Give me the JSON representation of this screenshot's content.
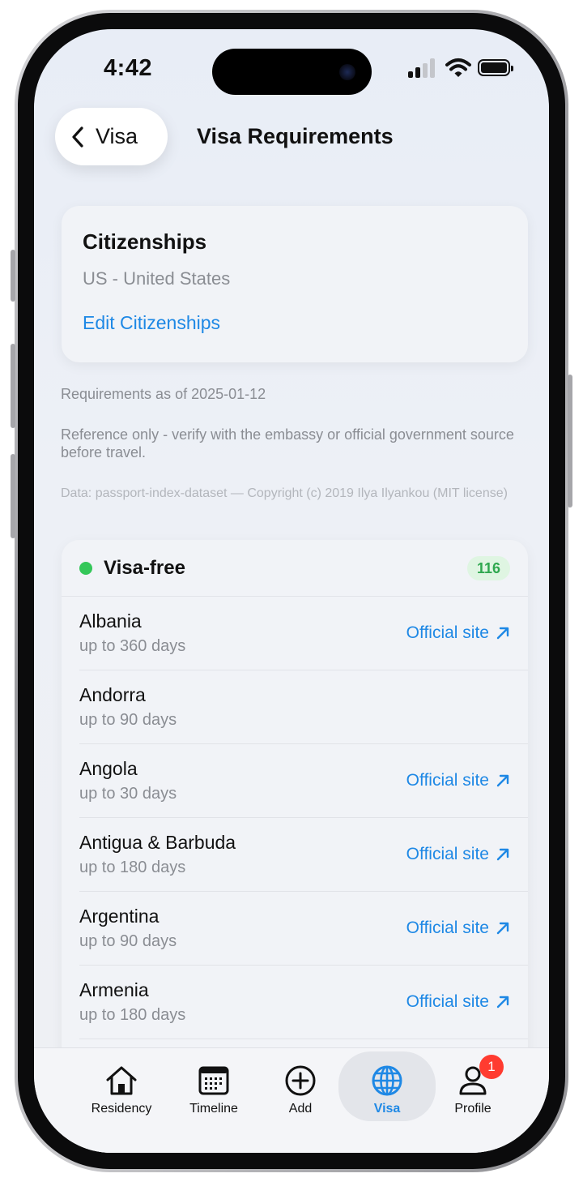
{
  "status": {
    "time": "4:42"
  },
  "nav": {
    "back_label": "Visa",
    "title": "Visa Requirements"
  },
  "citizenships": {
    "title": "Citizenships",
    "value": "US - United States",
    "edit_label": "Edit Citizenships"
  },
  "meta": {
    "as_of": "Requirements as of 2025-01-12",
    "disclaimer": "Reference only - verify with the embassy or official government source before travel.",
    "data_source": "Data: passport-index-dataset — Copyright (c) 2019 Ilya Ilyankou (MIT license)"
  },
  "visa_free": {
    "label": "Visa-free",
    "count": "116",
    "status_color": "#34c759",
    "rows": [
      {
        "country": "Albania",
        "duration": "up to 360 days",
        "link": "Official site"
      },
      {
        "country": "Andorra",
        "duration": "up to 90 days",
        "link": ""
      },
      {
        "country": "Angola",
        "duration": "up to 30 days",
        "link": "Official site"
      },
      {
        "country": "Antigua & Barbuda",
        "duration": "up to 180 days",
        "link": "Official site"
      },
      {
        "country": "Argentina",
        "duration": "up to 90 days",
        "link": "Official site"
      },
      {
        "country": "Armenia",
        "duration": "up to 180 days",
        "link": "Official site"
      }
    ]
  },
  "tabs": [
    {
      "label": "Residency",
      "icon": "house-icon"
    },
    {
      "label": "Timeline",
      "icon": "calendar-icon"
    },
    {
      "label": "Add",
      "icon": "plus-circle-icon"
    },
    {
      "label": "Visa",
      "icon": "globe-icon",
      "active": true
    },
    {
      "label": "Profile",
      "icon": "person-icon",
      "badge": "1"
    }
  ],
  "colors": {
    "accent": "#1e88e5",
    "badge": "#ff3b30"
  }
}
